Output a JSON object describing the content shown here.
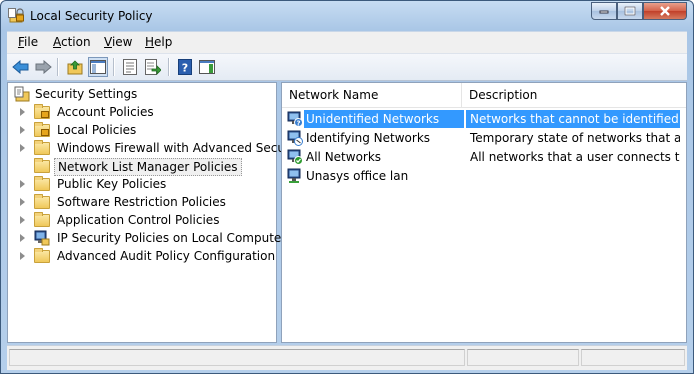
{
  "window": {
    "title": "Local Security Policy",
    "accent": "#3399ff"
  },
  "menu": [
    {
      "label": "File",
      "underline": "F",
      "rest": "ile"
    },
    {
      "label": "Action",
      "underline": "A",
      "rest": "ction"
    },
    {
      "label": "View",
      "underline": "V",
      "rest": "iew"
    },
    {
      "label": "Help",
      "underline": "H",
      "rest": "elp"
    }
  ],
  "toolbar": {
    "icons": [
      "back-arrow-icon",
      "forward-arrow-icon",
      "up-folder-icon",
      "show-hide-console-tree-icon",
      "properties-icon",
      "export-list-icon",
      "help-icon",
      "show-hide-action-pane-icon"
    ]
  },
  "tree": {
    "root": "Security Settings",
    "items": [
      {
        "label": "Account Policies",
        "icon": "folder-lock-icon",
        "expandable": true
      },
      {
        "label": "Local Policies",
        "icon": "folder-lock-icon",
        "expandable": true
      },
      {
        "label": "Windows Firewall with Advanced Security",
        "icon": "folder-icon",
        "expandable": true
      },
      {
        "label": "Network List Manager Policies",
        "icon": "folder-icon",
        "expandable": false,
        "selected": true
      },
      {
        "label": "Public Key Policies",
        "icon": "folder-icon",
        "expandable": true
      },
      {
        "label": "Software Restriction Policies",
        "icon": "folder-icon",
        "expandable": true
      },
      {
        "label": "Application Control Policies",
        "icon": "folder-icon",
        "expandable": true
      },
      {
        "label": "IP Security Policies on Local Computer",
        "icon": "ip-security-icon",
        "expandable": true
      },
      {
        "label": "Advanced Audit Policy Configuration",
        "icon": "folder-icon",
        "expandable": true
      }
    ]
  },
  "list": {
    "columns": [
      "Network Name",
      "Description"
    ],
    "rows": [
      {
        "name": "Unidentified Networks",
        "description": "Networks that cannot be identified ...",
        "icon": "network-unidentified-icon",
        "selected": true
      },
      {
        "name": "Identifying Networks",
        "description": "Temporary state of networks that ar...",
        "icon": "network-identifying-icon"
      },
      {
        "name": "All Networks",
        "description": "All networks that a user connects to.",
        "icon": "network-all-icon"
      },
      {
        "name": "Unasys office lan",
        "description": "",
        "icon": "network-icon"
      }
    ]
  }
}
